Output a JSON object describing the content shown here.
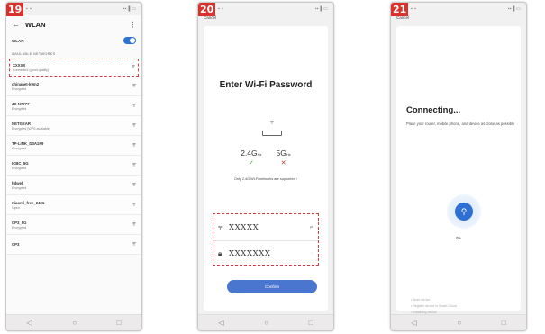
{
  "phone19": {
    "step": "19",
    "status_left": "▪ ▪",
    "status_right": "▪▪▐ ▭",
    "header": {
      "back_icon": "back-arrow-icon",
      "title": "WLAN",
      "more_icon": "more-vertical-icon"
    },
    "wlan_label": "WLAN",
    "wlan_enabled": true,
    "section_label": "AVAILABLE NETWORKS",
    "connected": {
      "name": "XXXXX",
      "status": "Connected (good quality)"
    },
    "networks": [
      {
        "name": "chinanet-k9m2",
        "status": "Encrypted"
      },
      {
        "name": "JD-N7777",
        "status": "Encrypted"
      },
      {
        "name": "NETGEAR",
        "status": "Encrypted (WPS available)"
      },
      {
        "name": "TP-LINK_D3A1F9",
        "status": "Encrypted"
      },
      {
        "name": "ICBC_5G",
        "status": "Encrypted"
      },
      {
        "name": "hdwell",
        "status": "Encrypted"
      },
      {
        "name": "Xiaomi_free_2401",
        "status": "Open"
      },
      {
        "name": "CP3_5G",
        "status": "Encrypted"
      },
      {
        "name": "CP3",
        "status": ""
      }
    ]
  },
  "phone20": {
    "step": "20",
    "status_left": "▪ ▪",
    "status_right": "▪▪▐ ▭",
    "cancel": "Cancel",
    "title": "Enter Wi-Fi Password",
    "band_24": "2.4G",
    "band_24_unit": "Hz",
    "band_5": "5G",
    "band_5_unit": "Hz",
    "band_24_mark": "✓",
    "band_5_mark": "✕",
    "band_note": "Only 2.4G Wi-Fi networks are supported ›",
    "ssid_value": "XXXXX",
    "password_value": "XXXXXXX",
    "confirm_label": "Confirm"
  },
  "phone21": {
    "step": "21",
    "status_left": "▪ ▪",
    "status_right": "▪▪▐ ▭",
    "cancel": "Cancel",
    "title": "Connecting...",
    "description": "Place your router, mobile phone, and device as close as possible",
    "progress": "0%",
    "progress_value": 0,
    "steps": [
      "• Scan device",
      "• Register device to Smart Cloud",
      "• Initializing device"
    ]
  },
  "nav_icons": [
    "back-icon",
    "home-icon",
    "recents-icon"
  ]
}
